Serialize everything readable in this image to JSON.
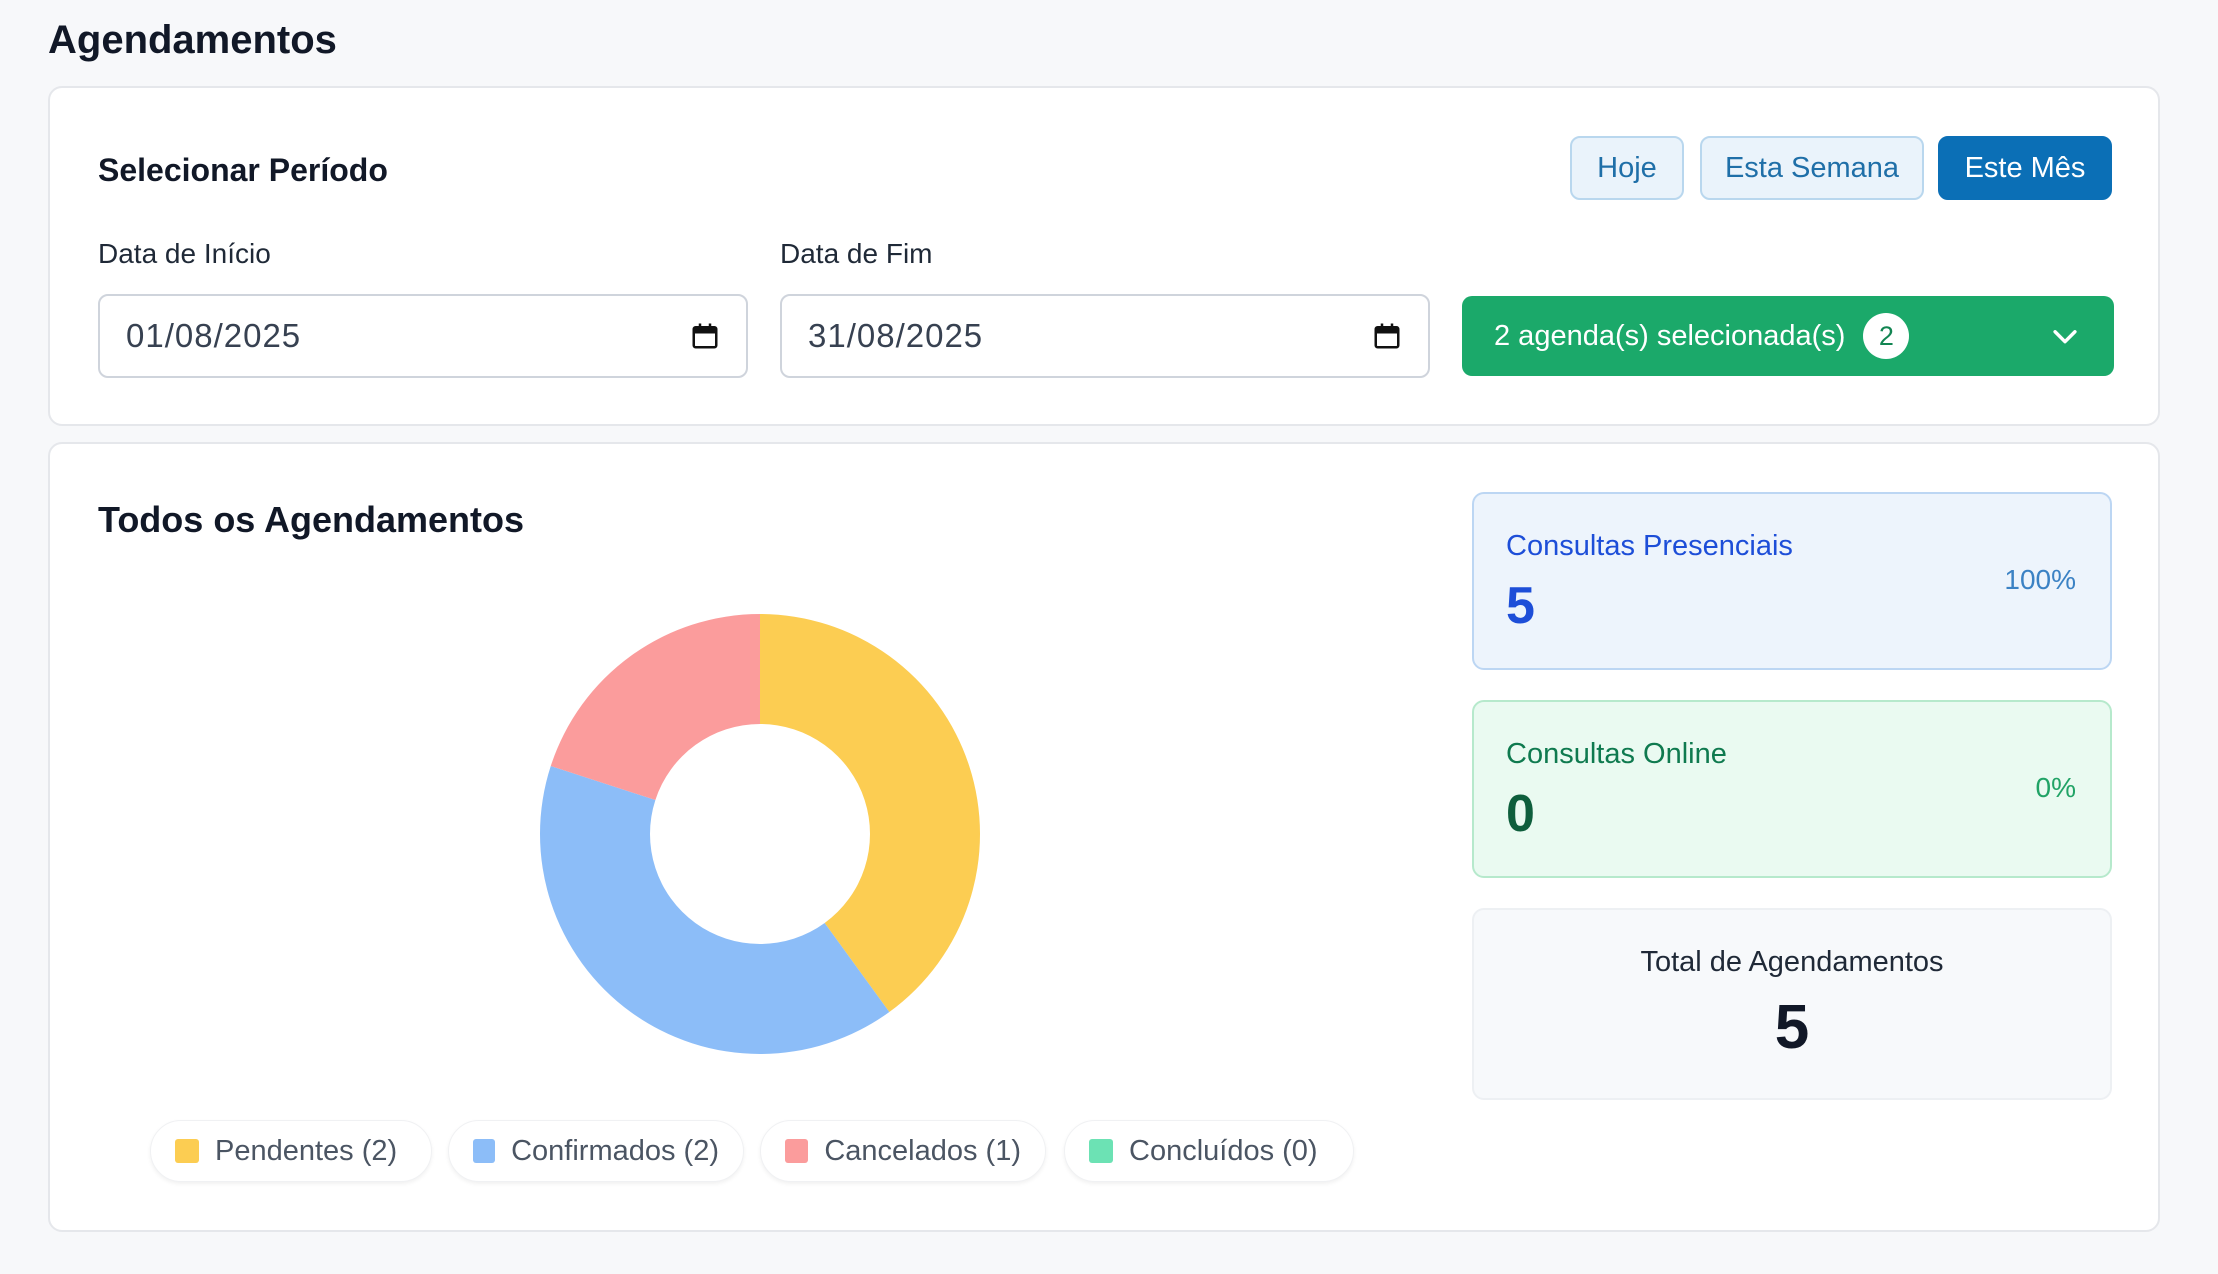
{
  "page": {
    "title": "Agendamentos"
  },
  "period": {
    "title": "Selecionar Período",
    "quick_buttons": [
      {
        "label": "Hoje",
        "active": false
      },
      {
        "label": "Esta Semana",
        "active": false
      },
      {
        "label": "Este Mês",
        "active": true
      }
    ],
    "start_label": "Data de Início",
    "start_value": "01/08/2025",
    "end_label": "Data de Fim",
    "end_value": "31/08/2025",
    "agenda_select": {
      "label": "2 agenda(s) selecionada(s)",
      "count": "2"
    }
  },
  "overview": {
    "title": "Todos os Agendamentos",
    "stats": {
      "presencial": {
        "label": "Consultas Presenciais",
        "value": "5",
        "percent": "100%"
      },
      "online": {
        "label": "Consultas Online",
        "value": "0",
        "percent": "0%"
      },
      "total": {
        "label": "Total de Agendamentos",
        "value": "5"
      }
    }
  },
  "colors": {
    "pending": "#fccd52",
    "confirmed": "#8cbdf8",
    "cancelled": "#fb9c9c",
    "completed": "#6ce2b4",
    "primary": "#0b6fb6",
    "success": "#1ba96a"
  },
  "icons": {
    "date": "calendar-icon",
    "dropdown": "chevron-down-icon"
  },
  "chart_data": {
    "type": "pie",
    "variant": "donut",
    "categories": [
      "Pendentes",
      "Confirmados",
      "Cancelados",
      "Concluídos"
    ],
    "values": [
      2,
      2,
      1,
      0
    ],
    "legend": [
      "Pendentes (2)",
      "Confirmados (2)",
      "Cancelados (1)",
      "Concluídos (0)"
    ],
    "colors": [
      "#fccd52",
      "#8cbdf8",
      "#fb9c9c",
      "#6ce2b4"
    ],
    "legend_position": "bottom"
  }
}
